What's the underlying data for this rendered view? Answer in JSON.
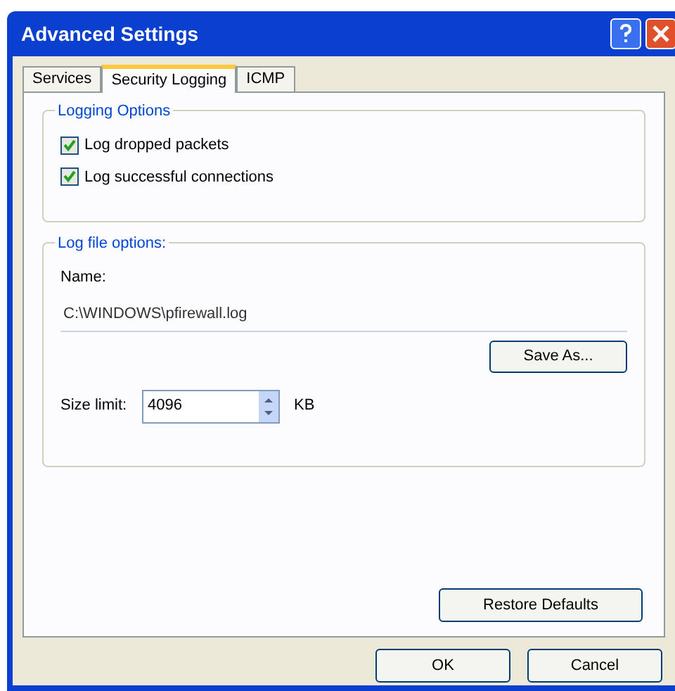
{
  "window": {
    "title": "Advanced Settings"
  },
  "tabs": [
    {
      "label": "Services",
      "selected": false
    },
    {
      "label": "Security Logging",
      "selected": true
    },
    {
      "label": "ICMP",
      "selected": false
    }
  ],
  "logging_options": {
    "title": "Logging Options",
    "checkboxes": [
      {
        "label": "Log dropped packets",
        "checked": true
      },
      {
        "label": "Log successful connections",
        "checked": true
      }
    ]
  },
  "log_file_options": {
    "title": "Log file options:",
    "name_label": "Name:",
    "name_value": "C:\\WINDOWS\\pfirewall.log",
    "save_as": "Save As...",
    "size_label": "Size limit:",
    "size_value": "4096",
    "size_unit": "KB"
  },
  "restore_defaults": "Restore Defaults",
  "buttons": [
    "OK",
    "Cancel"
  ]
}
